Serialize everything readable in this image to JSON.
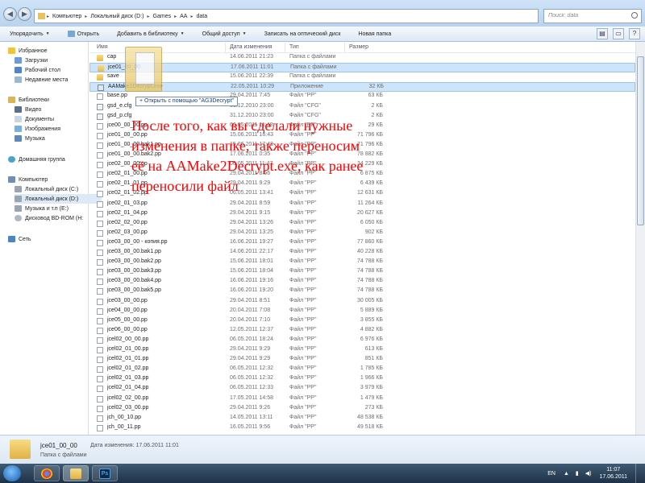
{
  "address": {
    "segments": [
      "Компьютер",
      "Локальный диск (D:)",
      "Games",
      "AA",
      "data"
    ],
    "search_placeholder": "Поиск: data"
  },
  "toolbar": {
    "organize": "Упорядочить",
    "open": "Открыть",
    "library": "Добавить в библиотеку",
    "share": "Общий доступ",
    "burn": "Записать на оптический диск",
    "new_folder": "Новая папка"
  },
  "nav": {
    "favorites": "Избранное",
    "downloads": "Загрузки",
    "desktop": "Рабочий стол",
    "recent": "Недавние места",
    "libraries": "Библиотеки",
    "video": "Видео",
    "documents": "Документы",
    "images": "Изображения",
    "music": "Музыка",
    "homegroup": "Домашняя группа",
    "computer": "Компьютер",
    "disk_c": "Локальный диск (C:)",
    "disk_d": "Локальный диск (D:)",
    "disk_e": "Музыка и т.п (E:)",
    "dvd": "Дисковод BD-ROM (H:",
    "network": "Сеть"
  },
  "columns": {
    "name": "Имя",
    "date": "Дата изменения",
    "type": "Тип",
    "size": "Размер"
  },
  "files": [
    {
      "name": "cap",
      "date": "14.06.2011 21:23",
      "type": "Папка с файлами",
      "size": "",
      "kind": "folder"
    },
    {
      "name": "jce01_00_00",
      "date": "17.06.2011 11:01",
      "type": "Папка с файлами",
      "size": "",
      "kind": "folder",
      "highlight": true
    },
    {
      "name": "save",
      "date": "15.06.2011 22:39",
      "type": "Папка с файлами",
      "size": "",
      "kind": "folder"
    },
    {
      "name": "AAMake2Decrypt.exe",
      "date": "22.05.2011 10:29",
      "type": "Приложение",
      "size": "32 КБ",
      "kind": "exe",
      "highlight": true
    },
    {
      "name": "base.pp",
      "date": "29.04.2011 7:45",
      "type": "Файл \"PP\"",
      "size": "63 КБ",
      "kind": "file"
    },
    {
      "name": "gsd_e.cfg",
      "date": "31.12.2010 23:00",
      "type": "Файл \"CFG\"",
      "size": "2 КБ",
      "kind": "cfg"
    },
    {
      "name": "gsd_p.cfg",
      "date": "31.12.2010 23:00",
      "type": "Файл \"CFG\"",
      "size": "2 КБ",
      "kind": "cfg"
    },
    {
      "name": "jce00_00_00.pp",
      "date": "06.05.2011 11:48",
      "type": "Файл \"PP\"",
      "size": "29 КБ",
      "kind": "file"
    },
    {
      "name": "jce01_00_00.pp",
      "date": "15.06.2011 16:43",
      "type": "Файл \"PP\"",
      "size": "71 796 КБ",
      "kind": "file"
    },
    {
      "name": "jce01_00_00.bak1.pp",
      "date": "15.06.2011 17:48",
      "type": "Файл \"PP\"",
      "size": "71 796 КБ",
      "kind": "file"
    },
    {
      "name": "jce01_00_00.bak2.pp",
      "date": "17.06.2011 0:35",
      "type": "Файл \"PP\"",
      "size": "78 882 КБ",
      "kind": "file"
    },
    {
      "name": "jce02_00_00.pp",
      "date": "06.05.2011 11:47",
      "type": "Файл \"PP\"",
      "size": "34 229 КБ",
      "kind": "file"
    },
    {
      "name": "jce02_01_00.pp",
      "date": "29.04.2011 8:56",
      "type": "Файл \"PP\"",
      "size": "6 875 КБ",
      "kind": "file"
    },
    {
      "name": "jce02_01_01.pp",
      "date": "29.04.2011 9:29",
      "type": "Файл \"PP\"",
      "size": "6 439 КБ",
      "kind": "file"
    },
    {
      "name": "jce02_01_02.pp",
      "date": "06.05.2011 13:41",
      "type": "Файл \"PP\"",
      "size": "12 631 КБ",
      "kind": "file"
    },
    {
      "name": "jce02_01_03.pp",
      "date": "29.04.2011 8:59",
      "type": "Файл \"PP\"",
      "size": "11 264 КБ",
      "kind": "file"
    },
    {
      "name": "jce02_01_04.pp",
      "date": "29.04.2011 9:15",
      "type": "Файл \"PP\"",
      "size": "20 627 КБ",
      "kind": "file"
    },
    {
      "name": "jce02_02_00.pp",
      "date": "29.04.2011 13:26",
      "type": "Файл \"PP\"",
      "size": "6 050 КБ",
      "kind": "file"
    },
    {
      "name": "jce02_03_00.pp",
      "date": "29.04.2011 13:25",
      "type": "Файл \"PP\"",
      "size": "902 КБ",
      "kind": "file"
    },
    {
      "name": "jce03_00_00 - копия.pp",
      "date": "16.06.2011 19:27",
      "type": "Файл \"PP\"",
      "size": "77 860 КБ",
      "kind": "file"
    },
    {
      "name": "jce03_00_00.bak1.pp",
      "date": "14.06.2011 22:17",
      "type": "Файл \"PP\"",
      "size": "40 228 КБ",
      "kind": "file"
    },
    {
      "name": "jce03_00_00.bak2.pp",
      "date": "15.06.2011 18:01",
      "type": "Файл \"PP\"",
      "size": "74 788 КБ",
      "kind": "file"
    },
    {
      "name": "jce03_00_00.bak3.pp",
      "date": "15.06.2011 18:04",
      "type": "Файл \"PP\"",
      "size": "74 788 КБ",
      "kind": "file"
    },
    {
      "name": "jce03_00_00.bak4.pp",
      "date": "16.06.2011 19:16",
      "type": "Файл \"PP\"",
      "size": "74 788 КБ",
      "kind": "file"
    },
    {
      "name": "jce03_00_00.bak5.pp",
      "date": "16.06.2011 19:20",
      "type": "Файл \"PP\"",
      "size": "74 788 КБ",
      "kind": "file"
    },
    {
      "name": "jce03_00_00.pp",
      "date": "29.04.2011 8:51",
      "type": "Файл \"PP\"",
      "size": "30 005 КБ",
      "kind": "file"
    },
    {
      "name": "jce04_00_00.pp",
      "date": "20.04.2011 7:08",
      "type": "Файл \"PP\"",
      "size": "5 889 КБ",
      "kind": "file"
    },
    {
      "name": "jce05_00_00.pp",
      "date": "20.04.2011 7:10",
      "type": "Файл \"PP\"",
      "size": "3 855 КБ",
      "kind": "file"
    },
    {
      "name": "jce06_00_00.pp",
      "date": "12.05.2011 12:37",
      "type": "Файл \"PP\"",
      "size": "4 882 КБ",
      "kind": "file"
    },
    {
      "name": "jcel02_00_00.pp",
      "date": "06.05.2011 18:24",
      "type": "Файл \"PP\"",
      "size": "6 976 КБ",
      "kind": "file"
    },
    {
      "name": "jcel02_01_00.pp",
      "date": "29.04.2011 9:29",
      "type": "Файл \"PP\"",
      "size": "613 КБ",
      "kind": "file"
    },
    {
      "name": "jcel02_01_01.pp",
      "date": "29.04.2011 9:29",
      "type": "Файл \"PP\"",
      "size": "851 КБ",
      "kind": "file"
    },
    {
      "name": "jcel02_01_02.pp",
      "date": "06.05.2011 12:32",
      "type": "Файл \"PP\"",
      "size": "1 785 КБ",
      "kind": "file"
    },
    {
      "name": "jcel02_01_03.pp",
      "date": "06.05.2011 12:32",
      "type": "Файл \"PP\"",
      "size": "1 966 КБ",
      "kind": "file"
    },
    {
      "name": "jcel02_01_04.pp",
      "date": "06.05.2011 12:33",
      "type": "Файл \"PP\"",
      "size": "3 979 КБ",
      "kind": "file"
    },
    {
      "name": "jcel02_02_00.pp",
      "date": "17.05.2011 14:58",
      "type": "Файл \"PP\"",
      "size": "1 479 КБ",
      "kind": "file"
    },
    {
      "name": "jcel02_03_00.pp",
      "date": "29.04.2011 9:26",
      "type": "Файл \"PP\"",
      "size": "273 КБ",
      "kind": "file"
    },
    {
      "name": "jch_00_10.pp",
      "date": "14.05.2011 13:11",
      "type": "Файл \"PP\"",
      "size": "48 538 КБ",
      "kind": "file"
    },
    {
      "name": "jch_00_11.pp",
      "date": "16.05.2011 9:56",
      "type": "Файл \"PP\"",
      "size": "49 518 КБ",
      "kind": "file"
    }
  ],
  "drag_tooltip": "+ Открыть с помощью \"AG3Decrypt\"",
  "annotation": "После того, как вы сделали нужные изменения в папке, также переносим её на AAMake2Decrypt.exe, как ранее переносили файл",
  "details": {
    "name": "jce01_00_00",
    "meta": "Дата изменения: 17.06.2011 11:01",
    "type": "Папка с файлами"
  },
  "taskbar": {
    "apps": [
      "chrome-icon",
      "explorer-icon",
      "photoshop-icon"
    ],
    "lang": "EN",
    "time": "11:07",
    "date": "17.06.2011"
  }
}
